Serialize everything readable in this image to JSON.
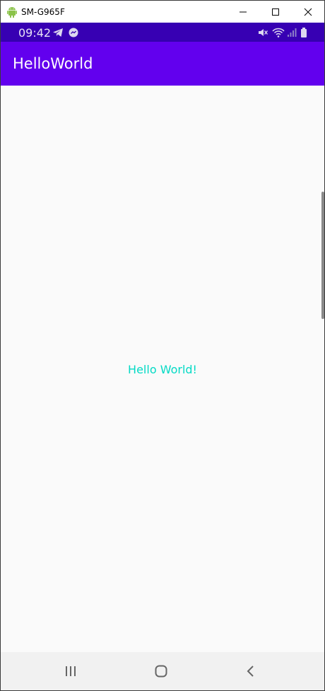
{
  "window": {
    "title": "SM-G965F",
    "android_icon": "android-icon",
    "controls": [
      "minimize-icon",
      "maximize-icon",
      "close-icon"
    ]
  },
  "status_bar": {
    "time": "09:42",
    "left_icons": [
      "telegram-icon",
      "messenger-icon"
    ],
    "right_icons": [
      "mute-icon",
      "wifi-icon",
      "signal-icon",
      "battery-icon"
    ],
    "background": "#3700b3"
  },
  "app_bar": {
    "title": "HelloWorld",
    "background": "#6200ee"
  },
  "content": {
    "text": "Hello World!",
    "text_color": "#03dac5"
  },
  "nav_bar": {
    "buttons": [
      "recents-icon",
      "home-icon",
      "back-icon"
    ]
  }
}
